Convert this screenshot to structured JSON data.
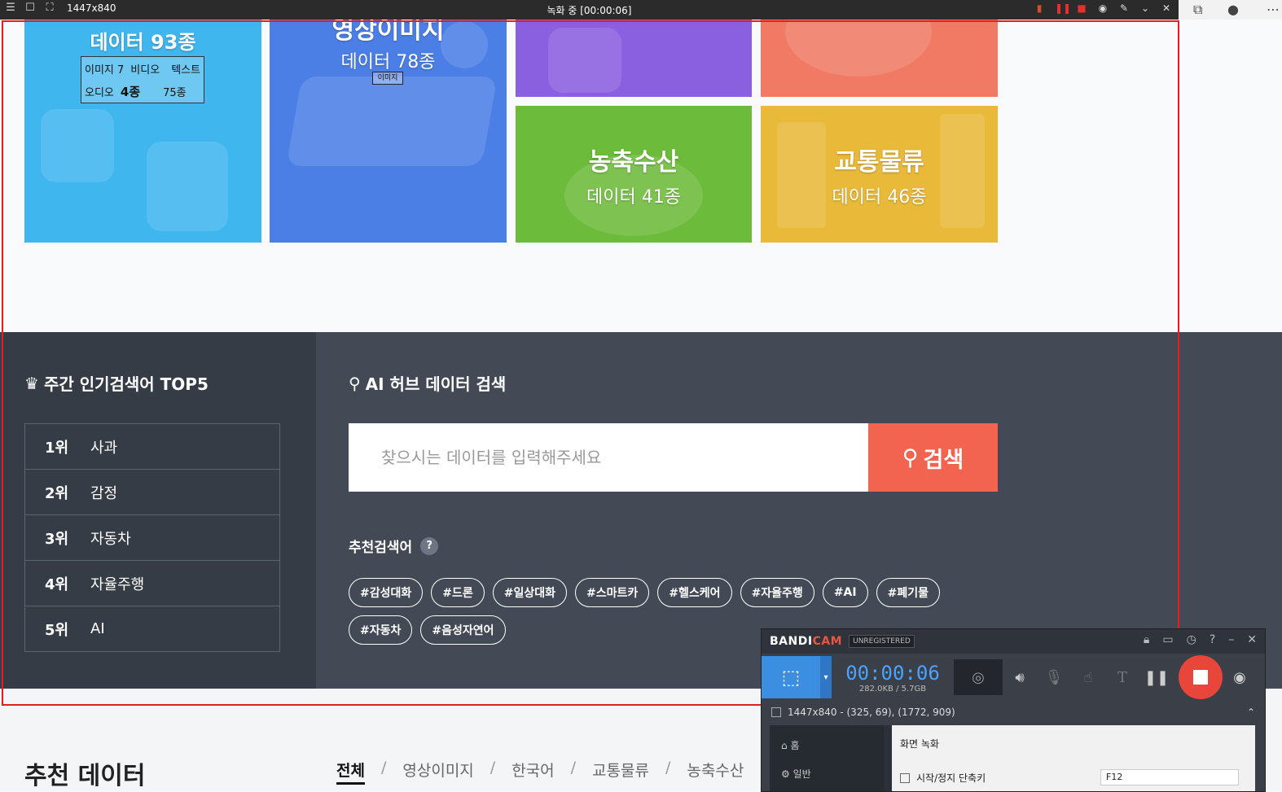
{
  "recorder_bar": {
    "dimensions": "1447x840",
    "status": "녹화 중 [00:00:06]"
  },
  "tiles": {
    "tile1": {
      "title": "데이터 93종"
    },
    "tile1_sub": {
      "row1_a": "이미지 7",
      "row1_b": "비디오",
      "row1_c": "텍스트",
      "row2_a": "오디오",
      "row2_b": "4종",
      "row2_c": "75종"
    },
    "tile2": {
      "title": "영상이미지",
      "subtitle": "데이터 78종",
      "overlay": "이미지"
    },
    "tile5": {
      "title": "농축수산",
      "subtitle": "데이터 41종"
    },
    "tile6": {
      "title": "교통물류",
      "subtitle": "데이터 46종"
    }
  },
  "popular": {
    "title": "주간 인기검색어 TOP5",
    "items": [
      {
        "rank": "1위",
        "label": "사과"
      },
      {
        "rank": "2위",
        "label": "감정"
      },
      {
        "rank": "3위",
        "label": "자동차"
      },
      {
        "rank": "4위",
        "label": "자율주행"
      },
      {
        "rank": "5위",
        "label": "AI"
      }
    ]
  },
  "search": {
    "title": "AI 허브 데이터 검색",
    "placeholder": "찾으시는 데이터를 입력해주세요",
    "button_label": "검색",
    "recommend_title": "추천검색어",
    "help": "?",
    "tags": [
      "#감성대화",
      "#드론",
      "#일상대화",
      "#스마트카",
      "#헬스케어",
      "#자율주행",
      "#AI",
      "#폐기물",
      "#자동차",
      "#음성자연어"
    ]
  },
  "recommended": {
    "title": "추천 데이터",
    "categories": [
      "전체",
      "영상이미지",
      "한국어",
      "교통물류",
      "농축수산"
    ],
    "separator": "/"
  },
  "bandicam": {
    "logo_a": "BANDI",
    "logo_b": "CAM",
    "unregistered": "UNREGISTERED",
    "time": "00:00:06",
    "size": "282.0KB / 5.7GB",
    "region": "1447x840 - (325, 69), (1772, 909)",
    "side_home": "홈",
    "side_general": "일반",
    "section": "화면 녹화",
    "hotkey_label": "시작/정지 단축키",
    "hotkey_value": "F12"
  },
  "colors": {
    "tile1": "#3fb6ee",
    "tile2": "#4c7fe6",
    "tile3": "#8a5fe0",
    "tile4": "#f07a63",
    "tile5": "#6dbb3a",
    "tile6": "#e9b93a",
    "accent": "#f2644f"
  }
}
